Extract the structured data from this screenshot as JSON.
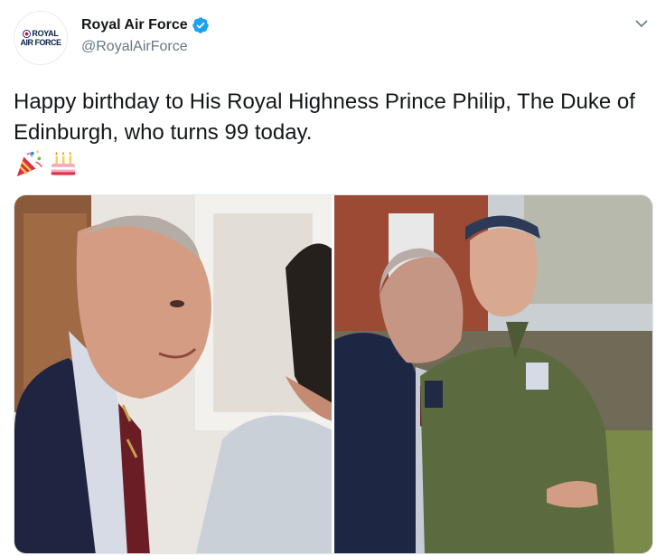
{
  "account": {
    "display_name": "Royal Air Force",
    "handle": "@RoyalAirForce",
    "avatar_logo_line1": "ROYAL",
    "avatar_logo_line2": "AIR FORCE",
    "verified_icon": "verified-badge-icon",
    "verified_color": "#1da1f2"
  },
  "tweet": {
    "text": "Happy birthday to His Royal Highness Prince Philip, The Duke of Edinburgh, who turns 99 today.",
    "emojis": [
      "party-popper-icon",
      "birthday-cake-icon"
    ]
  },
  "menu": {
    "icon": "chevron-down-icon"
  },
  "media": [
    {
      "name": "photo-left",
      "icon": "image"
    },
    {
      "name": "photo-right",
      "icon": "image"
    }
  ]
}
